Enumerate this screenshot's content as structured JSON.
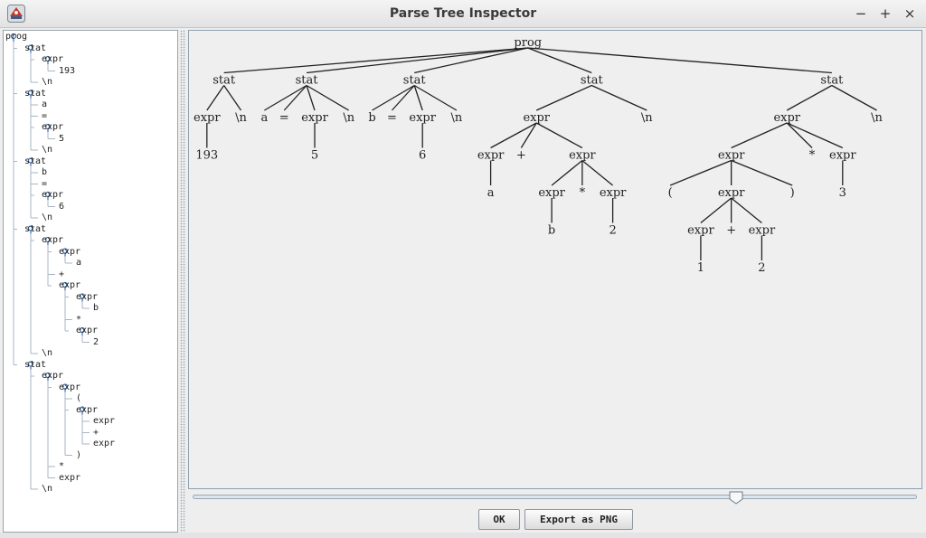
{
  "window": {
    "title": "Parse Tree Inspector",
    "minimize": "−",
    "maximize": "+",
    "close": "×"
  },
  "tree_outline": [
    {
      "t": "prog",
      "d": 0
    },
    {
      "t": "stat",
      "d": 1
    },
    {
      "t": "expr",
      "d": 2
    },
    {
      "t": "193",
      "d": 3
    },
    {
      "t": "\\n",
      "d": 2
    },
    {
      "t": "stat",
      "d": 1
    },
    {
      "t": "a",
      "d": 2
    },
    {
      "t": "=",
      "d": 2
    },
    {
      "t": "expr",
      "d": 2
    },
    {
      "t": "5",
      "d": 3
    },
    {
      "t": "\\n",
      "d": 2
    },
    {
      "t": "stat",
      "d": 1
    },
    {
      "t": "b",
      "d": 2
    },
    {
      "t": "=",
      "d": 2
    },
    {
      "t": "expr",
      "d": 2
    },
    {
      "t": "6",
      "d": 3
    },
    {
      "t": "\\n",
      "d": 2
    },
    {
      "t": "stat",
      "d": 1
    },
    {
      "t": "expr",
      "d": 2
    },
    {
      "t": "expr",
      "d": 3
    },
    {
      "t": "a",
      "d": 4
    },
    {
      "t": "+",
      "d": 3
    },
    {
      "t": "expr",
      "d": 3
    },
    {
      "t": "expr",
      "d": 4
    },
    {
      "t": "b",
      "d": 5
    },
    {
      "t": "*",
      "d": 4
    },
    {
      "t": "expr",
      "d": 4
    },
    {
      "t": "2",
      "d": 5
    },
    {
      "t": "\\n",
      "d": 2
    },
    {
      "t": "stat",
      "d": 1
    },
    {
      "t": "expr",
      "d": 2
    },
    {
      "t": "expr",
      "d": 3
    },
    {
      "t": "(",
      "d": 4
    },
    {
      "t": "expr",
      "d": 4
    },
    {
      "t": "expr",
      "d": 5
    },
    {
      "t": "+",
      "d": 5
    },
    {
      "t": "expr",
      "d": 5
    },
    {
      "t": ")",
      "d": 4
    },
    {
      "t": "*",
      "d": 3
    },
    {
      "t": "expr",
      "d": 3
    },
    {
      "t": "\\n",
      "d": 2
    }
  ],
  "parse_tree": {
    "t": "prog",
    "c": [
      {
        "t": "stat",
        "c": [
          {
            "t": "expr",
            "c": [
              {
                "t": "193"
              }
            ]
          },
          {
            "t": "\\n"
          }
        ]
      },
      {
        "t": "stat",
        "c": [
          {
            "t": "a"
          },
          {
            "t": "="
          },
          {
            "t": "expr",
            "c": [
              {
                "t": "5"
              }
            ]
          },
          {
            "t": "\\n"
          }
        ]
      },
      {
        "t": "stat",
        "c": [
          {
            "t": "b"
          },
          {
            "t": "="
          },
          {
            "t": "expr",
            "c": [
              {
                "t": "6"
              }
            ]
          },
          {
            "t": "\\n"
          }
        ]
      },
      {
        "t": "stat",
        "c": [
          {
            "t": "expr",
            "c": [
              {
                "t": "expr",
                "c": [
                  {
                    "t": "a"
                  }
                ]
              },
              {
                "t": "+"
              },
              {
                "t": "expr",
                "c": [
                  {
                    "t": "expr",
                    "c": [
                      {
                        "t": "b"
                      }
                    ]
                  },
                  {
                    "t": "*"
                  },
                  {
                    "t": "expr",
                    "c": [
                      {
                        "t": "2"
                      }
                    ]
                  }
                ]
              }
            ]
          },
          {
            "t": "\\n"
          }
        ]
      },
      {
        "t": "stat",
        "c": [
          {
            "t": "expr",
            "c": [
              {
                "t": "expr",
                "c": [
                  {
                    "t": "("
                  },
                  {
                    "t": "expr",
                    "c": [
                      {
                        "t": "expr",
                        "c": [
                          {
                            "t": "1"
                          }
                        ]
                      },
                      {
                        "t": "+"
                      },
                      {
                        "t": "expr",
                        "c": [
                          {
                            "t": "2"
                          }
                        ]
                      }
                    ]
                  },
                  {
                    "t": ")"
                  }
                ]
              },
              {
                "t": "*"
              },
              {
                "t": "expr",
                "c": [
                  {
                    "t": "3"
                  }
                ]
              }
            ]
          },
          {
            "t": "\\n"
          }
        ]
      }
    ]
  },
  "scale_slider": {
    "value_fraction": 0.75
  },
  "buttons": {
    "ok_label": "OK",
    "export_label": "Export as PNG"
  }
}
